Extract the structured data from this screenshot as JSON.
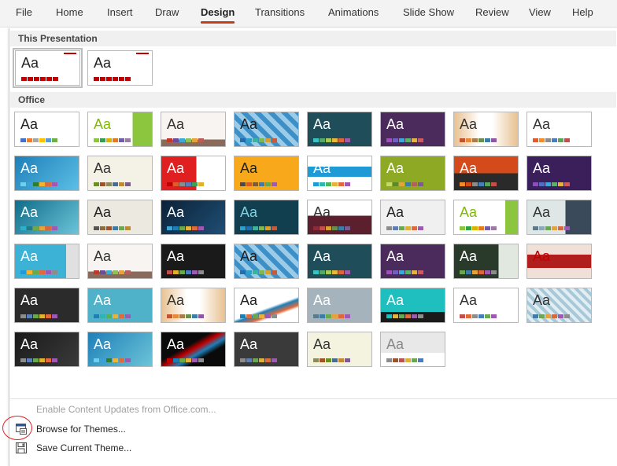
{
  "ribbon": {
    "tabs": [
      {
        "label": "File"
      },
      {
        "label": "Home"
      },
      {
        "label": "Insert"
      },
      {
        "label": "Draw"
      },
      {
        "label": "Design",
        "active": true
      },
      {
        "label": "Transitions"
      },
      {
        "label": "Animations"
      },
      {
        "label": "Slide Show"
      },
      {
        "label": "Review"
      },
      {
        "label": "View"
      },
      {
        "label": "Help"
      }
    ]
  },
  "themes_panel": {
    "this_presentation_header": "This Presentation",
    "office_header": "Office",
    "thumbnail_label": "Aa",
    "this_presentation_count": 2,
    "office_count": 46
  },
  "menu": {
    "enable_updates_label": "Enable Content Updates from Office.com...",
    "browse_label": "Browse for Themes...",
    "save_label": "Save Current Theme..."
  },
  "colors": {
    "accent_red": "#c43e1c",
    "highlight_circle": "#e02020"
  }
}
